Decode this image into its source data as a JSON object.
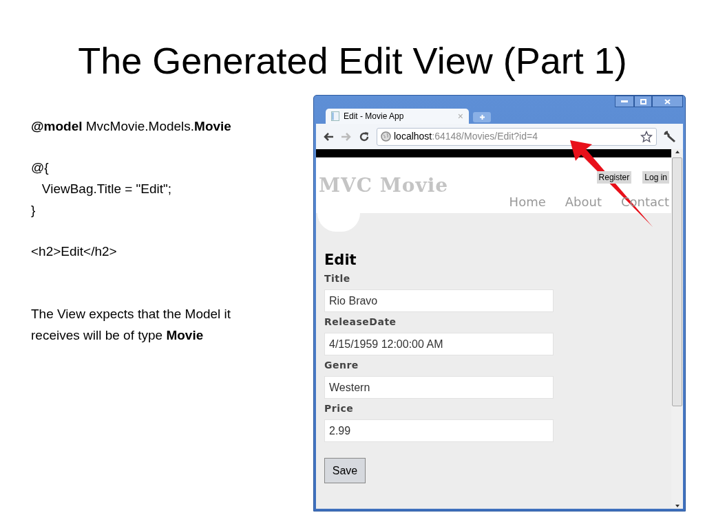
{
  "slide": {
    "title": "The Generated Edit View (Part 1)",
    "paragraphs": [
      [
        "**@model** MvcMovie.Models.**Movie**"
      ],
      [
        "@{",
        "   ViewBag.Title = \"Edit\";",
        "}"
      ],
      [
        "<h2>Edit</h2>"
      ],
      [
        "The View expects that the Model it receives will be of type **Movie**"
      ]
    ]
  },
  "browser": {
    "tab": {
      "title": "Edit - Movie App",
      "close": "×"
    },
    "address": {
      "host": "localhost",
      "path": ":64148/Movies/Edit?id=4"
    },
    "page": {
      "site_title": "MVC Movie",
      "auth_links": [
        "Register",
        "Log in"
      ],
      "nav": [
        "Home",
        "About",
        "Contact"
      ],
      "heading": "Edit",
      "fields": [
        {
          "label": "Title",
          "value": "Rio Bravo"
        },
        {
          "label": "ReleaseDate",
          "value": "4/15/1959 12:00:00 AM"
        },
        {
          "label": "Genre",
          "value": "Western"
        },
        {
          "label": "Price",
          "value": "2.99"
        }
      ],
      "button": "Save"
    }
  }
}
